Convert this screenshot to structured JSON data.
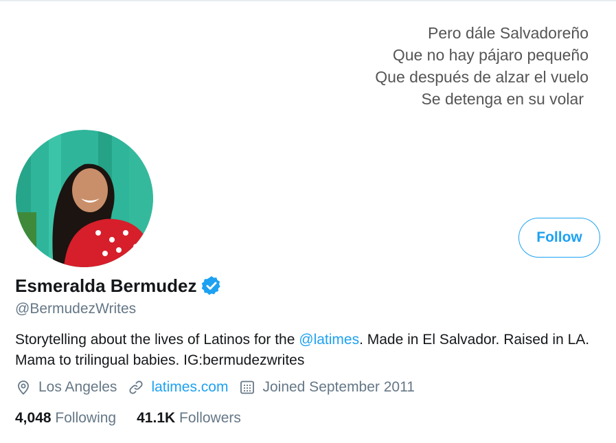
{
  "banner": {
    "poem_lines": [
      "Pero dále Salvadoreño",
      "Que no hay pájaro pequeño",
      "Que después de alzar el vuelo",
      "Se detenga en su volar"
    ]
  },
  "profile": {
    "name": "Esmeralda Bermudez",
    "handle": "@BermudezWrites",
    "verified": true,
    "bio": {
      "before_mention": "Storytelling about the lives of Latinos for the ",
      "mention": "@latimes",
      "after_mention": ". Made in El Salvador. Raised in LA. Mama to trilingual babies. IG:bermudezwrites"
    },
    "location": "Los Angeles",
    "website": "latimes.com",
    "joined": "Joined September 2011",
    "following_count": "4,048",
    "following_label": "Following",
    "followers_count": "41.1K",
    "followers_label": "Followers"
  },
  "actions": {
    "follow_label": "Follow"
  },
  "colors": {
    "accent": "#1da1f2",
    "secondary_text": "#657786",
    "primary_text": "#14171a"
  },
  "icons": [
    "verified-badge-icon",
    "location-pin-icon",
    "link-icon",
    "calendar-icon"
  ]
}
